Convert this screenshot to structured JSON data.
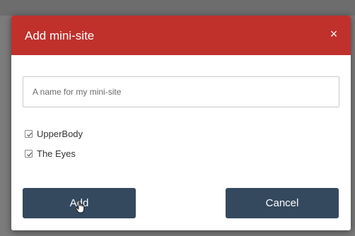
{
  "dialog": {
    "title": "Add mini-site",
    "close_label": "×",
    "name_input": {
      "placeholder": "A name for my mini-site",
      "value": ""
    },
    "checkboxes": [
      {
        "label": "UpperBody",
        "checked": true
      },
      {
        "label": "The Eyes",
        "checked": true
      }
    ],
    "add_label": "Add",
    "cancel_label": "Cancel"
  },
  "colors": {
    "header": "#c0312c",
    "button": "#34495e",
    "overlay": "#7b7b7b"
  },
  "icons": {
    "close": "close-icon",
    "checkbox": "checkbox-checked-icon",
    "cursor": "hand-pointer-icon"
  }
}
